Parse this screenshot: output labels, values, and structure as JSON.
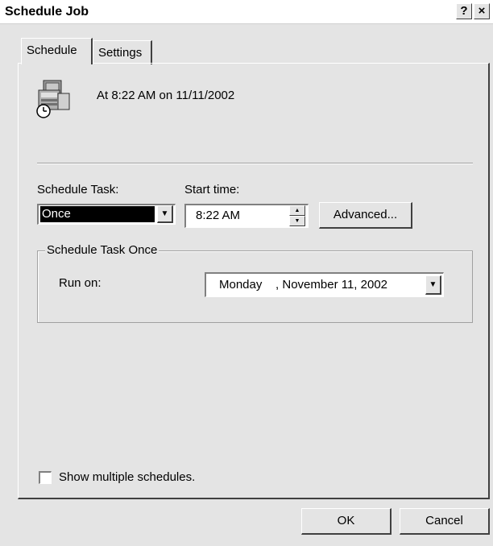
{
  "window": {
    "title": "Schedule Job",
    "help_button": "?",
    "close_button": "×"
  },
  "tabs": [
    {
      "label": "Schedule"
    },
    {
      "label": "Settings"
    }
  ],
  "summary": {
    "text": "At 8:22 AM on 11/11/2002",
    "icon": "scheduled-task-icon"
  },
  "schedule": {
    "task_label": "Schedule Task:",
    "task_value": "Once",
    "start_time_label": "Start time:",
    "start_time_value": "8:22 AM",
    "advanced_button": "Advanced..."
  },
  "group": {
    "legend": "Schedule Task Once",
    "run_on_label": "Run on:",
    "run_on_value": "Monday    , November 11, 2002"
  },
  "options": {
    "show_multiple": "Show multiple schedules.",
    "show_multiple_checked": false
  },
  "buttons": {
    "ok": "OK",
    "cancel": "Cancel"
  }
}
